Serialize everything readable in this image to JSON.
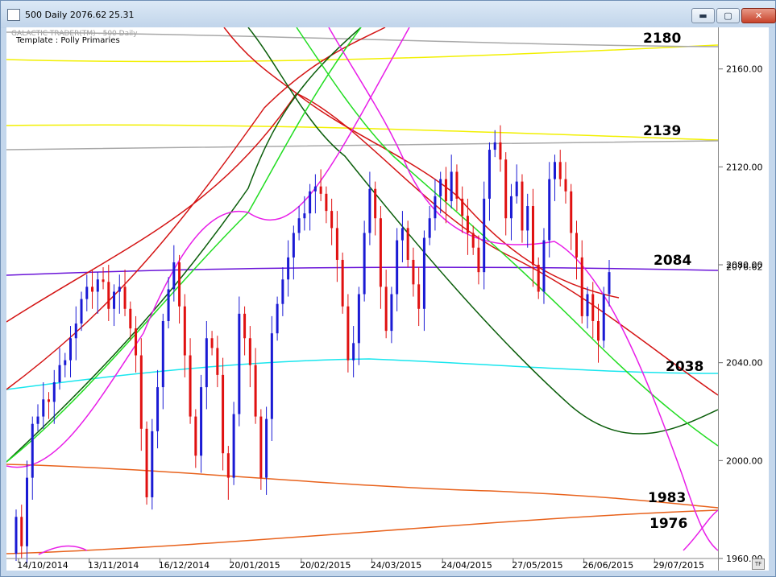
{
  "window": {
    "title": "500 Daily 2076.62",
    "title_extra": "25.31",
    "buttons": {
      "minimize": "▬",
      "restore": "▢",
      "close": "✕"
    }
  },
  "chart_header": {
    "provider": "GALACTIC TRADER(TM) - 500 Daily",
    "template": "Template : Polly Primaries"
  },
  "tf_label": "TF",
  "chart_data": {
    "type": "candlestick",
    "title": "",
    "xlabel": "",
    "ylabel": "",
    "ylim": [
      1960,
      2177
    ],
    "y_ticks": [
      1960,
      2000,
      2040,
      2080,
      2120,
      2160
    ],
    "y_tick_labels": [
      "1960.00",
      "2000.00",
      "2040.00",
      "2080.00",
      "2120.00",
      "2160.00"
    ],
    "x_tick_labels": [
      "14/10/2014",
      "13/11/2014",
      "16/12/2014",
      "20/01/2015",
      "20/02/2015",
      "24/03/2015",
      "24/04/2015",
      "27/05/2015",
      "26/06/2015",
      "29/07/2015"
    ],
    "last_price": "2076.62",
    "horizontal_levels": [
      {
        "label": "2180",
        "color": "#000000"
      },
      {
        "label": "2139",
        "color": "#000000"
      },
      {
        "label": "2084",
        "color": "#000000"
      },
      {
        "label": "2038",
        "color": "#000000"
      },
      {
        "label": "1983",
        "color": "#000000"
      },
      {
        "label": "1976",
        "color": "#000000"
      }
    ],
    "colors": {
      "up_candle": "#1a1ad4",
      "down_candle": "#e01010",
      "purple_line": "#6a14d8",
      "cyan_line": "#18e6ee",
      "orange_line": "#e8621c",
      "yellow_line": "#f2f000",
      "gray_line": "#a8a8a8",
      "red_cycle": "#d41414",
      "dark_green_cycle": "#0b5e0b",
      "green_cycle": "#22dd22",
      "magenta_cycle": "#e81ee8"
    },
    "candles": [
      [
        1962,
        1977
      ],
      [
        1977,
        1965
      ],
      [
        1965,
        1993
      ],
      [
        1993,
        2015
      ],
      [
        2015,
        2018
      ],
      [
        2018,
        2025
      ],
      [
        2025,
        2024
      ],
      [
        2024,
        2032
      ],
      [
        2032,
        2039
      ],
      [
        2039,
        2041
      ],
      [
        2041,
        2050
      ],
      [
        2050,
        2056
      ],
      [
        2056,
        2066
      ],
      [
        2066,
        2071
      ],
      [
        2071,
        2069
      ],
      [
        2069,
        2074
      ],
      [
        2074,
        2073
      ],
      [
        2073,
        2062
      ],
      [
        2062,
        2069
      ],
      [
        2069,
        2071
      ],
      [
        2071,
        2062
      ],
      [
        2062,
        2054
      ],
      [
        2054,
        2043
      ],
      [
        2043,
        2013
      ],
      [
        2013,
        1985
      ],
      [
        1985,
        2012
      ],
      [
        2012,
        2030
      ],
      [
        2030,
        2057
      ],
      [
        2057,
        2070
      ],
      [
        2070,
        2081
      ],
      [
        2081,
        2063
      ],
      [
        2063,
        2043
      ],
      [
        2043,
        2018
      ],
      [
        2018,
        2002
      ],
      [
        2002,
        2030
      ],
      [
        2030,
        2050
      ],
      [
        2050,
        2046
      ],
      [
        2046,
        2035
      ],
      [
        2035,
        2003
      ],
      [
        2003,
        1993
      ],
      [
        1993,
        2019
      ],
      [
        2019,
        2060
      ],
      [
        2060,
        2050
      ],
      [
        2050,
        2039
      ],
      [
        2039,
        2018
      ],
      [
        2018,
        1993
      ],
      [
        1993,
        2017
      ],
      [
        2017,
        2052
      ],
      [
        2052,
        2064
      ],
      [
        2064,
        2074
      ],
      [
        2074,
        2083
      ],
      [
        2083,
        2093
      ],
      [
        2093,
        2099
      ],
      [
        2099,
        2101
      ],
      [
        2101,
        2110
      ],
      [
        2110,
        2112
      ],
      [
        2112,
        2109
      ],
      [
        2109,
        2102
      ],
      [
        2102,
        2095
      ],
      [
        2095,
        2082
      ],
      [
        2082,
        2063
      ],
      [
        2063,
        2041
      ],
      [
        2041,
        2048
      ],
      [
        2048,
        2068
      ],
      [
        2068,
        2093
      ],
      [
        2093,
        2111
      ],
      [
        2111,
        2099
      ],
      [
        2099,
        2071
      ],
      [
        2071,
        2053
      ],
      [
        2053,
        2068
      ],
      [
        2068,
        2090
      ],
      [
        2090,
        2095
      ],
      [
        2095,
        2082
      ],
      [
        2082,
        2072
      ],
      [
        2072,
        2062
      ],
      [
        2062,
        2091
      ],
      [
        2091,
        2099
      ],
      [
        2099,
        2108
      ],
      [
        2108,
        2115
      ],
      [
        2115,
        2106
      ],
      [
        2106,
        2118
      ],
      [
        2118,
        2107
      ],
      [
        2107,
        2100
      ],
      [
        2100,
        2093
      ],
      [
        2093,
        2087
      ],
      [
        2087,
        2077
      ],
      [
        2077,
        2107
      ],
      [
        2107,
        2127
      ],
      [
        2127,
        2130
      ],
      [
        2130,
        2123
      ],
      [
        2123,
        2099
      ],
      [
        2099,
        2108
      ],
      [
        2108,
        2114
      ],
      [
        2114,
        2094
      ],
      [
        2094,
        2104
      ],
      [
        2104,
        2080
      ],
      [
        2080,
        2069
      ],
      [
        2069,
        2090
      ],
      [
        2090,
        2115
      ],
      [
        2115,
        2122
      ],
      [
        2122,
        2115
      ],
      [
        2115,
        2110
      ],
      [
        2110,
        2093
      ],
      [
        2093,
        2083
      ],
      [
        2083,
        2059
      ],
      [
        2059,
        2068
      ],
      [
        2068,
        2057
      ],
      [
        2057,
        2049
      ],
      [
        2049,
        2068
      ],
      [
        2068,
        2077
      ]
    ]
  }
}
